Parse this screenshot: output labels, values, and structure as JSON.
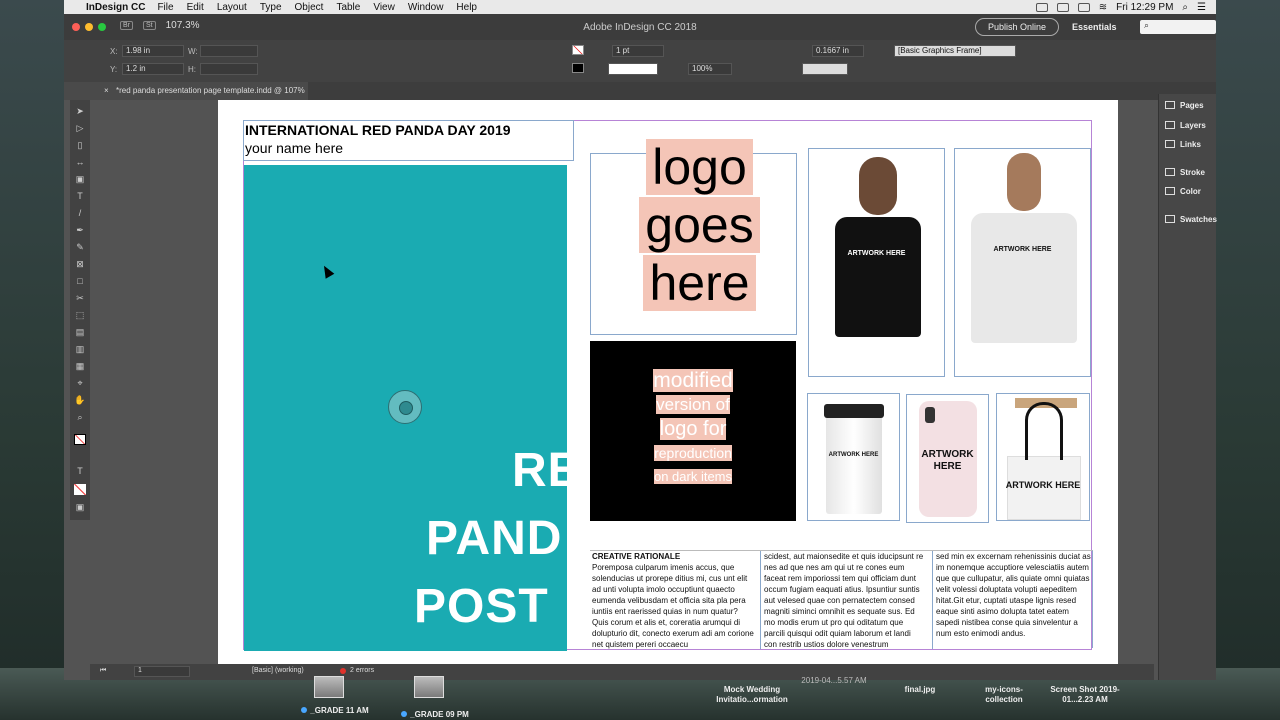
{
  "menubar": {
    "app": "InDesign CC",
    "items": [
      "File",
      "Edit",
      "Layout",
      "Type",
      "Object",
      "Table",
      "View",
      "Window",
      "Help"
    ],
    "clock": "Fri 12:29 PM"
  },
  "titlebar": {
    "zoom": "107.3%",
    "title": "Adobe InDesign CC 2018",
    "publish": "Publish Online",
    "workspace": "Essentials",
    "badge_br": "Br",
    "badge_st": "St"
  },
  "control": {
    "x": "1.98 in",
    "y": "1.2 in",
    "w_label": "W:",
    "h_label": "H:",
    "x_label": "X:",
    "y_label": "Y:",
    "stroke_weight": "1 pt",
    "scale": "100%",
    "offset": "0.1667 in",
    "object_style": "[Basic Graphics Frame]"
  },
  "doctab": {
    "close": "×",
    "title": "*red panda presentation page template.indd @ 107%"
  },
  "panels": [
    "Pages",
    "Layers",
    "Links",
    "Stroke",
    "Color",
    "Swatches"
  ],
  "status": {
    "page": "1",
    "style": "[Basic] (working)",
    "errors": "2 errors"
  },
  "layout": {
    "title": "INTERNATIONAL RED PANDA DAY 2019",
    "subtitle": "your name here",
    "poster_lines": [
      "RE",
      "PAND",
      "POST"
    ],
    "logo_lines": [
      "logo",
      "goes",
      "here"
    ],
    "dark_lines": [
      "modified",
      "version of",
      "logo for",
      "reproduction",
      "on dark items"
    ],
    "artwork_label": "ARTWORK HERE",
    "artwork_label_mug": "ARTWORK HERE",
    "rationale": {
      "heading": "CREATIVE RATIONALE",
      "col1": "Poremposa culparum imenis accus, que solenducias ut prorepe ditius mi, cus unt elit ad unti volupta imolo occuptiunt quaecto eumenda velibusdam et officia sita pla pera iuntiis ent raerissed quias in num quatur? Quis corum et alis et, coreratia arumqui di dolupturio dit, conecto exerum adi am corione net quistem pereri occaecu",
      "col2": "scidest, aut maionsedite et quis iducipsunt re nes ad que nes am qui ut re cones eum faceat rem imporiossi tem qui officiam dunt occum fugiam eaquati atius. Ipsuntiur suntis aut velesed quae con pernatectem consed magniti siminci omnihit es sequate sus. Ed mo modis erum ut pro qui oditatum que parcili quisqui odit quiam laborum et landi con restrib ustios dolore venestrum",
      "col3": "sed min ex excernam rehenissinis duciat as im nonemque accuptiore velesciatiis autem que que cullupatur, alis quiate omni quiatas velit volessi doluptata volupti aepeditem hitat.Git etur, cuptati utaspe lignis resed eaque sinti asimo dolupta tatet eatem sapedi nistibea conse quia sinvelentur a num esto enimodi andus."
    }
  },
  "dock": [
    {
      "label": "_GRADE 11 AM",
      "dot": true
    },
    {
      "label": "_GRADE 09 PM",
      "dot": true
    },
    {
      "label": "Mock Wedding Invitatio...ormation",
      "dot": false
    },
    {
      "label": "final.jpg",
      "dot": false
    },
    {
      "label": "my-icons-collection",
      "dot": false
    },
    {
      "label": "Screen Shot 2019-01...2.23 AM",
      "dot": false
    }
  ],
  "dock_extra": "2019-04...5.57 AM",
  "colors": {
    "teal": "#1aabb2",
    "peach": "#f4c5b7",
    "accent": "#49a7ff"
  }
}
